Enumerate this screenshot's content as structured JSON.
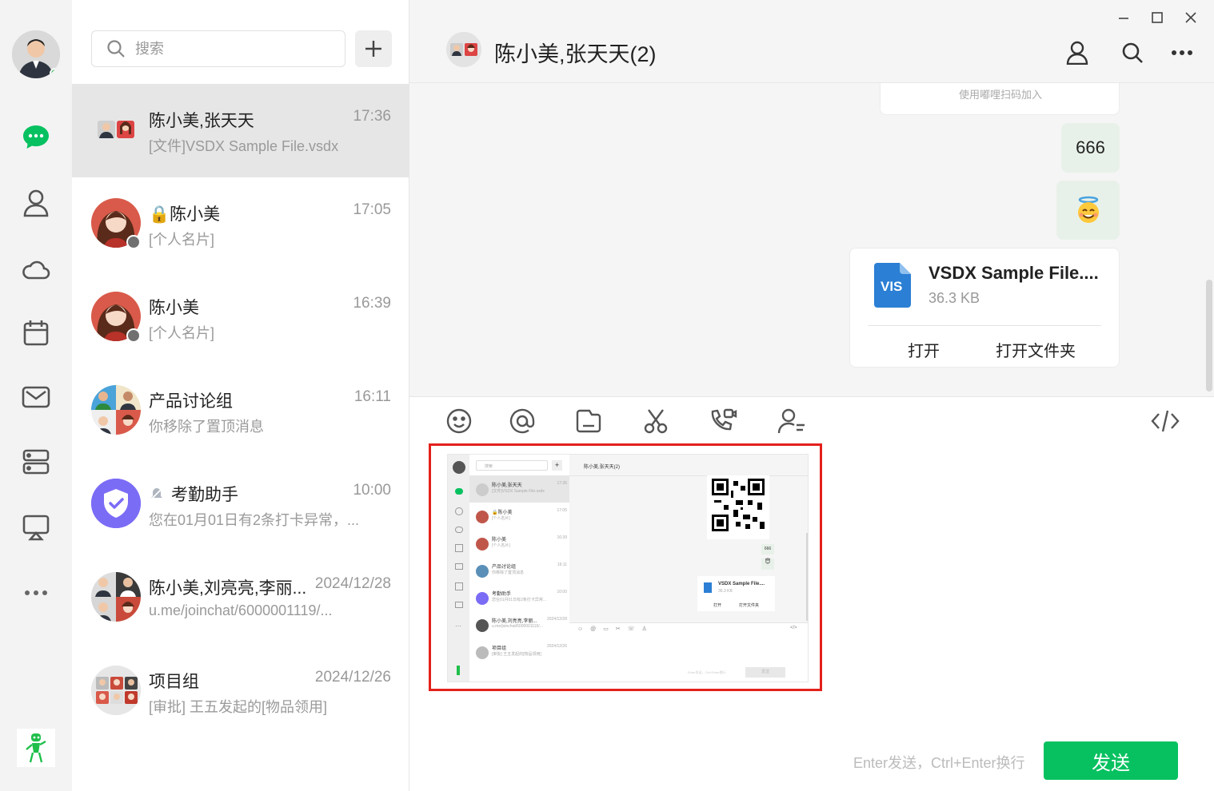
{
  "search": {
    "placeholder": "搜索"
  },
  "sessions": [
    {
      "name": "陈小美,张天天",
      "time": "17:36",
      "preview": "[文件]VSDX Sample File.vsdx"
    },
    {
      "name": "陈小美",
      "time": "17:05",
      "preview": "[个人名片]"
    },
    {
      "name": "陈小美",
      "time": "16:39",
      "preview": "[个人名片]"
    },
    {
      "name": "产品讨论组",
      "time": "16:11",
      "preview": "你移除了置顶消息"
    },
    {
      "name": "考勤助手",
      "time": "10:00",
      "preview": "您在01月01日有2条打卡异常，..."
    },
    {
      "name": "陈小美,刘亮亮,李丽...",
      "time": "2024/12/28",
      "preview": "u.me/joinchat/6000001119/..."
    },
    {
      "name": "项目组",
      "time": "2024/12/26",
      "preview": "[审批] 王五发起的[物品领用]"
    }
  ],
  "chat": {
    "title": "陈小美,张天天(2)",
    "qr_hint": "使用嘟哩扫码加入",
    "msg_text": "666",
    "file": {
      "name": "VSDX Sample File....",
      "size": "36.3 KB",
      "type_label": "VIS",
      "open": "打开",
      "open_folder": "打开文件夹"
    }
  },
  "composer": {
    "hint": "Enter发送，Ctrl+Enter换行",
    "send": "发送"
  },
  "thumbnail": {
    "title": "陈小美,张天天(2)",
    "search": "搜索",
    "rows": [
      {
        "name": "陈小美,张天天",
        "time": "17:36",
        "preview": "[文件]VSDX Sample File.vsdx"
      },
      {
        "name": "🔒陈小美",
        "time": "17:05",
        "preview": "[个人名片]"
      },
      {
        "name": "陈小美",
        "time": "16:39",
        "preview": "[个人名片]"
      },
      {
        "name": "产品讨论组",
        "time": "16:11",
        "preview": "你移除了置顶消息"
      },
      {
        "name": "考勤助手",
        "time": "10:00",
        "preview": "您在01月01日有2条打卡异常..."
      },
      {
        "name": "陈小美,刘亮亮,李丽...",
        "time": "2024/12/28",
        "preview": "u.me/joinchat/6000001119/..."
      },
      {
        "name": "项目组",
        "time": "2024/12/26",
        "preview": "[审批] 王五发起的[物品领用]"
      }
    ],
    "msg": "666",
    "file_name": "VSDX Sample File....",
    "file_size": "36.3 KB",
    "open": "打开",
    "open_folder": "打开文件夹",
    "hint": "Enter发送，Ctrl+Enter换行",
    "send": "发送"
  },
  "colors": {
    "accent": "#07c160",
    "online": "#19b44a",
    "highlight": "#e4201b",
    "bubble": "#e8f1e9",
    "assistant": "#7b6cf6"
  }
}
